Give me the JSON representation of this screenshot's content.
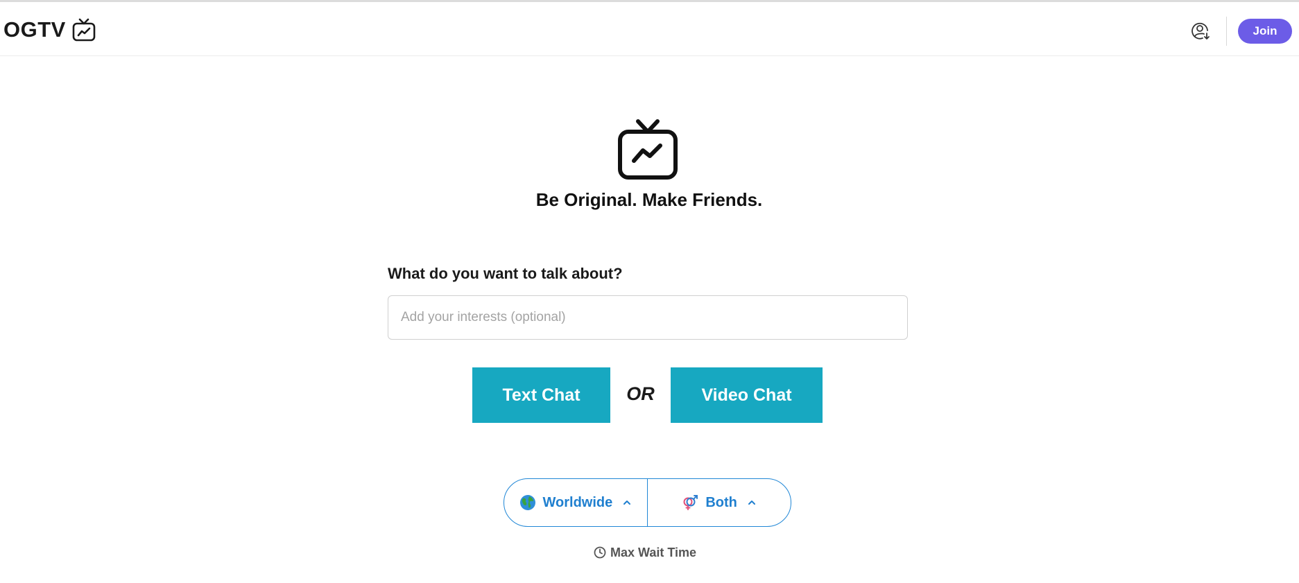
{
  "header": {
    "brand": "OGTV",
    "brand_icon": "tv-trend-icon",
    "account_icon": "user-circle-arrow-icon",
    "join_label": "Join",
    "join_color": "#6c5ce7"
  },
  "hero": {
    "icon": "tv-trend-icon",
    "tagline": "Be Original. Make Friends."
  },
  "interests": {
    "label": "What do you want to talk about?",
    "placeholder": "Add your interests (optional)",
    "value": ""
  },
  "actions": {
    "text_chat": "Text Chat",
    "or": "OR",
    "video_chat": "Video Chat",
    "button_color": "#17a8c1"
  },
  "filters": {
    "location": {
      "label": "Worldwide",
      "icon": "globe-icon"
    },
    "gender": {
      "label": "Both",
      "icon": "gender-both-icon"
    },
    "accent_color": "#1f86d6"
  },
  "wait": {
    "label": "Max Wait Time",
    "icon": "clock-icon"
  }
}
